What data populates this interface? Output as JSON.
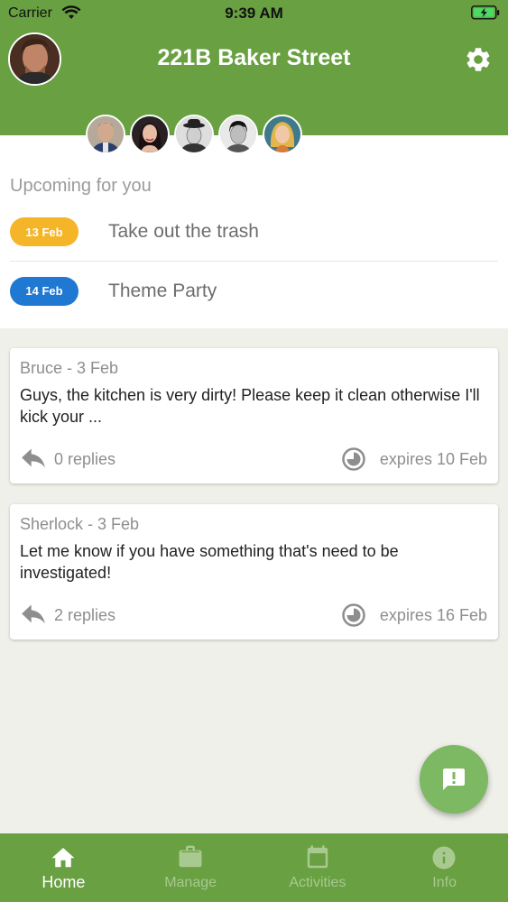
{
  "status_bar": {
    "carrier": "Carrier",
    "time": "9:39 AM"
  },
  "header": {
    "title": "221B Baker Street"
  },
  "members": [
    "member-1",
    "member-2",
    "member-3",
    "member-4",
    "member-5"
  ],
  "upcoming": {
    "heading": "Upcoming for you",
    "items": [
      {
        "date": "13 Feb",
        "label": "Take out the trash",
        "color": "#f5b529"
      },
      {
        "date": "14 Feb",
        "label": "Theme Party",
        "color": "#1f78d1"
      }
    ]
  },
  "posts": [
    {
      "author": "Bruce - 3 Feb",
      "body": "Guys, the kitchen is very dirty! Please keep it clean otherwise I'll kick your ...",
      "replies": "0 replies",
      "expires": "expires 10 Feb"
    },
    {
      "author": "Sherlock - 3 Feb",
      "body": "Let me know if you have something that's need to be investigated!",
      "replies": "2 replies",
      "expires": "expires 16 Feb"
    }
  ],
  "tabs": [
    {
      "label": "Home",
      "icon": "home-icon",
      "active": true
    },
    {
      "label": "Manage",
      "icon": "briefcase-icon",
      "active": false
    },
    {
      "label": "Activities",
      "icon": "calendar-icon",
      "active": false
    },
    {
      "label": "Info",
      "icon": "info-icon",
      "active": false
    }
  ],
  "colors": {
    "brand": "#68a042",
    "fab": "#7db862",
    "badge_yellow": "#f5b529",
    "badge_blue": "#1f78d1"
  }
}
